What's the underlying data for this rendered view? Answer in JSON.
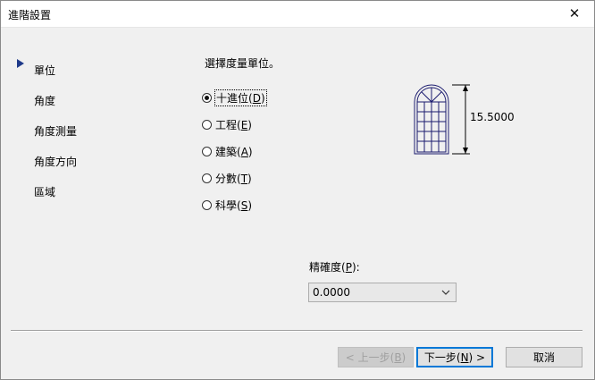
{
  "window": {
    "title": "進階設置",
    "close_glyph": "✕"
  },
  "sidebar": {
    "items": [
      {
        "label": "單位",
        "active": true
      },
      {
        "label": "角度"
      },
      {
        "label": "角度測量"
      },
      {
        "label": "角度方向"
      },
      {
        "label": "區域"
      }
    ]
  },
  "main": {
    "prompt": "選擇度量單位。",
    "units": [
      {
        "label": "十進位",
        "key": "D",
        "checked": true
      },
      {
        "label": "工程",
        "key": "E"
      },
      {
        "label": "建築",
        "key": "A"
      },
      {
        "label": "分數",
        "key": "T"
      },
      {
        "label": "科學",
        "key": "S"
      }
    ],
    "preview_dimension": "15.5000",
    "precision": {
      "label": "精確度",
      "key": "P",
      "value": "0.0000"
    }
  },
  "buttons": {
    "back": {
      "prefix": "< 上一步(",
      "key": "B",
      "suffix": ")"
    },
    "next": {
      "prefix": "下一步(",
      "key": "N",
      "suffix": ") >"
    },
    "cancel": {
      "label": "取消"
    }
  },
  "colors": {
    "accent": "#0078d7",
    "arrow": "#1f3a8a",
    "drawing": "#1a1a6e"
  },
  "icons": [
    "arrow-right-icon",
    "close-icon",
    "chevron-down-icon",
    "window-drawing-icon"
  ]
}
